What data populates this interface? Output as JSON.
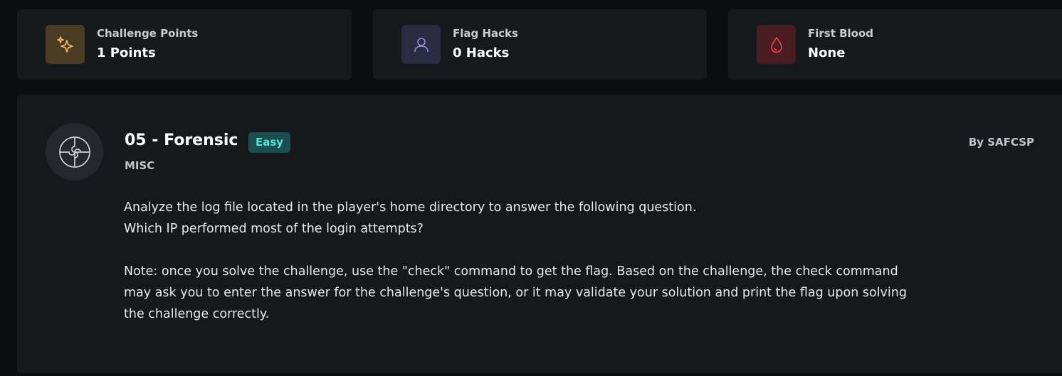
{
  "stats": [
    {
      "label": "Challenge Points",
      "value": "1 Points",
      "icon": "sparkles-icon",
      "icon_bg": "#4a3c22",
      "icon_color": "#f3bd6a"
    },
    {
      "label": "Flag Hacks",
      "value": "0 Hacks",
      "icon": "user-icon",
      "icon_bg": "#2a2b40",
      "icon_color": "#8f8ee0"
    },
    {
      "label": "First Blood",
      "value": "None",
      "icon": "blood-drop-icon",
      "icon_bg": "#4a1c20",
      "icon_color": "#e8414b"
    }
  ],
  "challenge": {
    "icon": "puzzle-icon",
    "title": "05 - Forensic",
    "difficulty": "Easy",
    "category": "MISC",
    "author": "By SAFCSP",
    "description": {
      "line1": "Analyze the log file located in the player's home directory to answer the following question.",
      "line2": "Which IP performed most of the login attempts?",
      "note": "Note: once you solve the challenge, use the \"check\" command to get the flag. Based on the challenge, the check command may ask you to enter the answer for the challenge's question, or it may validate your solution and print the flag upon solving the challenge correctly."
    }
  }
}
